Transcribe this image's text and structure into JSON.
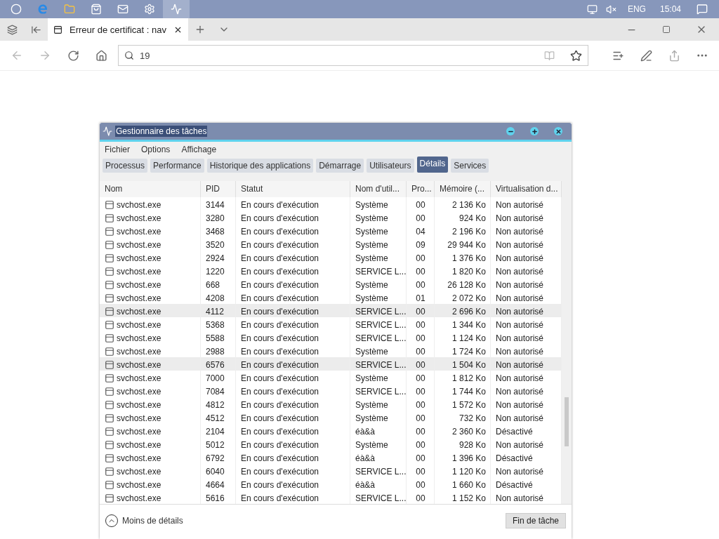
{
  "taskbar": {
    "apps": [
      {
        "kind": "cortana",
        "selected": false
      },
      {
        "kind": "edge",
        "selected": false
      },
      {
        "kind": "folder",
        "selected": false
      },
      {
        "kind": "store",
        "selected": false
      },
      {
        "kind": "mail",
        "selected": false
      },
      {
        "kind": "settings",
        "selected": false
      },
      {
        "kind": "taskmgr",
        "selected": true
      }
    ],
    "language": "ENG",
    "time": "15:04"
  },
  "browser": {
    "tab_title": "Erreur de certificat : nav",
    "address": "19"
  },
  "window": {
    "title": "Gestionnaire des tâches",
    "menu": [
      "Fichier",
      "Options",
      "Affichage"
    ],
    "tabs": [
      {
        "label": "Processus",
        "selected": false
      },
      {
        "label": "Performance",
        "selected": false
      },
      {
        "label": "Historique des applications",
        "selected": false
      },
      {
        "label": "Démarrage",
        "selected": false
      },
      {
        "label": "Utilisateurs",
        "selected": false
      },
      {
        "label": "Détails",
        "selected": true
      },
      {
        "label": "Services",
        "selected": false
      }
    ],
    "table": {
      "columns": [
        "Nom",
        "PID",
        "Statut",
        "Nom d'util...",
        "Pro...",
        "Mémoire (...",
        "Virtualisation d..."
      ],
      "rows": [
        {
          "cells": [
            "svchost.exe",
            "3144",
            "En cours d'exécution",
            "Système",
            "00",
            "2 136 Ko",
            "Non autorisé"
          ],
          "highlighted": false
        },
        {
          "cells": [
            "svchost.exe",
            "3280",
            "En cours d'exécution",
            "Système",
            "00",
            "924 Ko",
            "Non autorisé"
          ],
          "highlighted": false
        },
        {
          "cells": [
            "svchost.exe",
            "3468",
            "En cours d'exécution",
            "Système",
            "04",
            "2 196 Ko",
            "Non autorisé"
          ],
          "highlighted": false
        },
        {
          "cells": [
            "svchost.exe",
            "3520",
            "En cours d'exécution",
            "Système",
            "09",
            "29 944 Ko",
            "Non autorisé"
          ],
          "highlighted": false
        },
        {
          "cells": [
            "svchost.exe",
            "2924",
            "En cours d'exécution",
            "Système",
            "00",
            "1 376 Ko",
            "Non autorisé"
          ],
          "highlighted": false
        },
        {
          "cells": [
            "svchost.exe",
            "1220",
            "En cours d'exécution",
            "SERVICE L...",
            "00",
            "1 820 Ko",
            "Non autorisé"
          ],
          "highlighted": false
        },
        {
          "cells": [
            "svchost.exe",
            "668",
            "En cours d'exécution",
            "Système",
            "00",
            "26 128 Ko",
            "Non autorisé"
          ],
          "highlighted": false
        },
        {
          "cells": [
            "svchost.exe",
            "4208",
            "En cours d'exécution",
            "Système",
            "01",
            "2 072 Ko",
            "Non autorisé"
          ],
          "highlighted": false
        },
        {
          "cells": [
            "svchost.exe",
            "4112",
            "En cours d'exécution",
            "SERVICE L...",
            "00",
            "2 696 Ko",
            "Non autorisé"
          ],
          "highlighted": true
        },
        {
          "cells": [
            "svchost.exe",
            "5368",
            "En cours d'exécution",
            "SERVICE L...",
            "00",
            "1 344 Ko",
            "Non autorisé"
          ],
          "highlighted": false
        },
        {
          "cells": [
            "svchost.exe",
            "5588",
            "En cours d'exécution",
            "SERVICE L...",
            "00",
            "1 124 Ko",
            "Non autorisé"
          ],
          "highlighted": false
        },
        {
          "cells": [
            "svchost.exe",
            "2988",
            "En cours d'exécution",
            "Système",
            "00",
            "1 724 Ko",
            "Non autorisé"
          ],
          "highlighted": false
        },
        {
          "cells": [
            "svchost.exe",
            "6576",
            "En cours d'exécution",
            "SERVICE L...",
            "00",
            "1 504 Ko",
            "Non autorisé"
          ],
          "highlighted": true
        },
        {
          "cells": [
            "svchost.exe",
            "7000",
            "En cours d'exécution",
            "Système",
            "00",
            "1 812 Ko",
            "Non autorisé"
          ],
          "highlighted": false
        },
        {
          "cells": [
            "svchost.exe",
            "7084",
            "En cours d'exécution",
            "SERVICE L...",
            "00",
            "1 744 Ko",
            "Non autorisé"
          ],
          "highlighted": false
        },
        {
          "cells": [
            "svchost.exe",
            "4812",
            "En cours d'exécution",
            "Système",
            "00",
            "1 572 Ko",
            "Non autorisé"
          ],
          "highlighted": false
        },
        {
          "cells": [
            "svchost.exe",
            "4512",
            "En cours d'exécution",
            "Système",
            "00",
            "732 Ko",
            "Non autorisé"
          ],
          "highlighted": false
        },
        {
          "cells": [
            "svchost.exe",
            "2104",
            "En cours d'exécution",
            "éà&à",
            "00",
            "2 360 Ko",
            "Désactivé"
          ],
          "highlighted": false
        },
        {
          "cells": [
            "svchost.exe",
            "5012",
            "En cours d'exécution",
            "Système",
            "00",
            "928 Ko",
            "Non autorisé"
          ],
          "highlighted": false
        },
        {
          "cells": [
            "svchost.exe",
            "6792",
            "En cours d'exécution",
            "éà&à",
            "00",
            "1 396 Ko",
            "Désactivé"
          ],
          "highlighted": false
        },
        {
          "cells": [
            "svchost.exe",
            "6040",
            "En cours d'exécution",
            "SERVICE L...",
            "00",
            "1 120 Ko",
            "Non autorisé"
          ],
          "highlighted": false
        },
        {
          "cells": [
            "svchost.exe",
            "4664",
            "En cours d'exécution",
            "éà&à",
            "00",
            "1 660 Ko",
            "Désactivé"
          ],
          "highlighted": false
        },
        {
          "cells": [
            "svchost.exe",
            "5616",
            "En cours d'exécution",
            "SERVICE L...",
            "00",
            "1 152 Ko",
            "Non autorisé"
          ],
          "highlighted": false
        }
      ]
    },
    "footer": {
      "toggle": "Moins de détails",
      "button": "Fin de tâche"
    }
  }
}
